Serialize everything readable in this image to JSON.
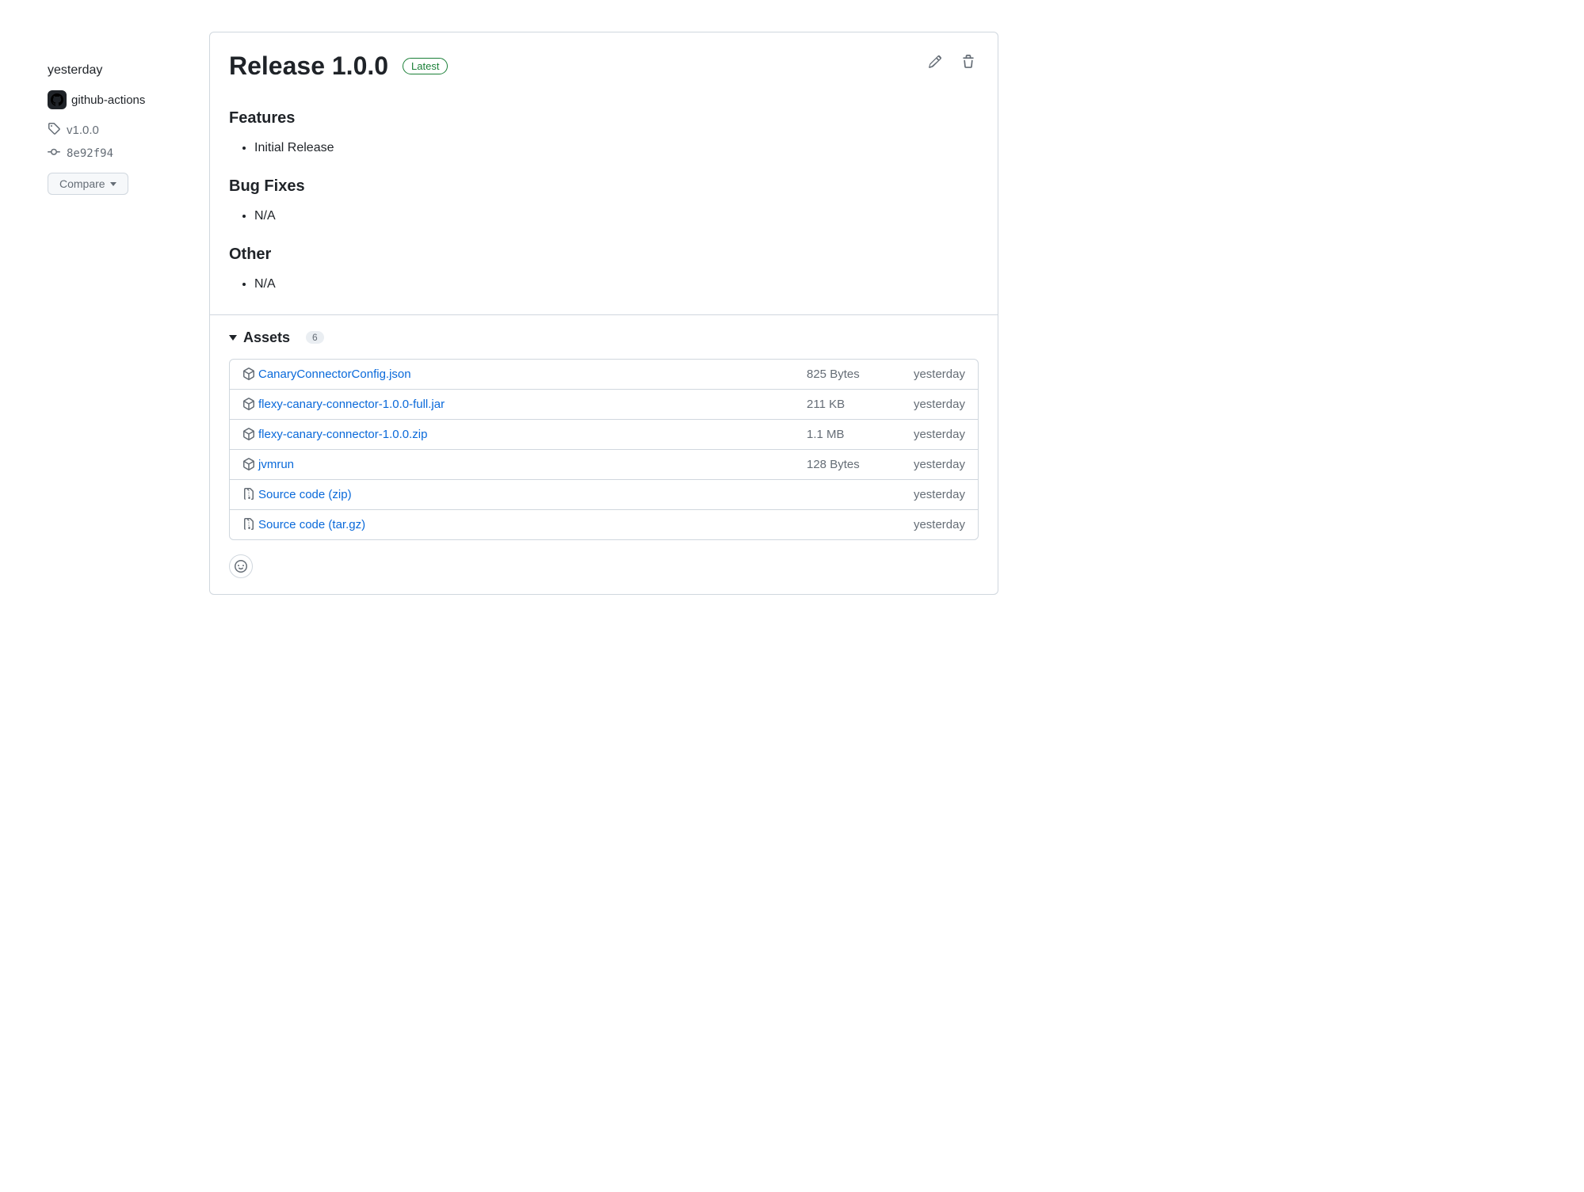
{
  "sidebar": {
    "time": "yesterday",
    "author_name": "github-actions",
    "tag": "v1.0.0",
    "commit": "8e92f94",
    "compare_label": "Compare"
  },
  "release": {
    "title": "Release 1.0.0",
    "badge": "Latest",
    "sections": {
      "features": {
        "heading": "Features",
        "item": "Initial Release"
      },
      "bugfixes": {
        "heading": "Bug Fixes",
        "item": "N/A"
      },
      "other": {
        "heading": "Other",
        "item": "N/A"
      }
    }
  },
  "assets": {
    "heading": "Assets",
    "count": "6",
    "items": [
      {
        "icon": "package",
        "name": "CanaryConnectorConfig.json",
        "suffix": "",
        "size": "825 Bytes",
        "time": "yesterday"
      },
      {
        "icon": "package",
        "name": "flexy-canary-connector-1.0.0-full.jar",
        "suffix": "",
        "size": "211 KB",
        "time": "yesterday"
      },
      {
        "icon": "package",
        "name": "flexy-canary-connector-1.0.0.zip",
        "suffix": "",
        "size": "1.1 MB",
        "time": "yesterday"
      },
      {
        "icon": "package",
        "name": "jvmrun",
        "suffix": "",
        "size": "128 Bytes",
        "time": "yesterday"
      },
      {
        "icon": "zip",
        "name": "Source code",
        "suffix": " (zip)",
        "size": "",
        "time": "yesterday"
      },
      {
        "icon": "zip",
        "name": "Source code",
        "suffix": " (tar.gz)",
        "size": "",
        "time": "yesterday"
      }
    ]
  }
}
